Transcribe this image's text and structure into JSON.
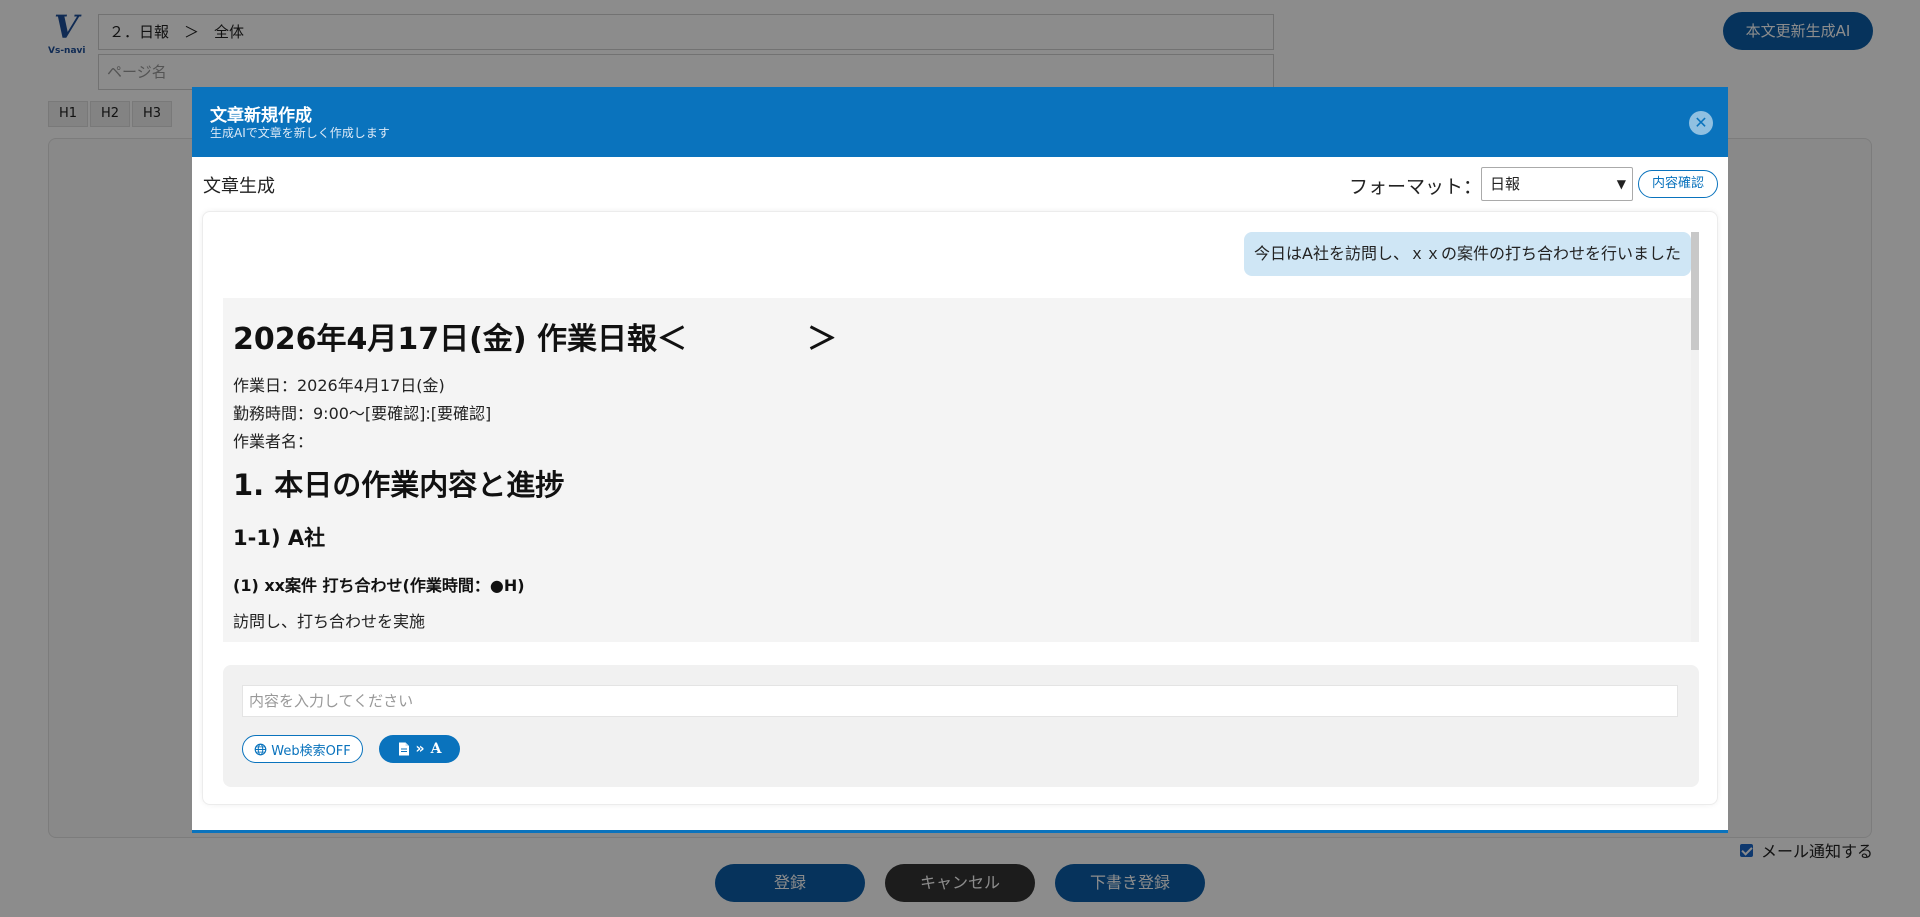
{
  "background": {
    "logo": {
      "mark": "V",
      "name": "Vs-navi"
    },
    "breadcrumb": "２．日報　＞　全体",
    "page_name_placeholder": "ページ名",
    "heading_buttons": [
      "H1",
      "H2",
      "H3"
    ],
    "top_ai_button": "本文更新生成AI",
    "mail_notify_label": "メール通知する",
    "buttons": {
      "register": "登録",
      "cancel": "キャンセル",
      "draft": "下書き登録"
    }
  },
  "modal": {
    "title": "文章新規作成",
    "subtitle": "生成AIで文章を新しく作成します",
    "close_glyph": "✕",
    "section_label": "文章生成",
    "format_label": "フォーマット：",
    "format_selected": "日報",
    "confirm_button": "内容確認",
    "user_message": "今日はA社を訪問し、ｘｘの案件の打ち合わせを行いました",
    "response": {
      "title": "2026年4月17日(金) 作業日報＜　　　　＞",
      "work_date": "作業日：2026年4月17日(金)",
      "work_hours": "勤務時間：9:00～[要確認]:[要確認]",
      "worker": "作業者名：",
      "h1": "1. 本日の作業内容と進捗",
      "h2": "1-1) A社",
      "h3": "(1) xx案件 打ち合わせ(作業時間：●H)",
      "text": "訪問し、打ち合わせを実施"
    },
    "prompt_placeholder": "内容を入力してください",
    "web_search_button": "Web検索OFF",
    "convert_button_glyph": "»",
    "convert_button_letter": "A"
  },
  "icons": {
    "globe": "globe-icon",
    "document": "document-icon",
    "close": "close-icon",
    "chevron": "chevron-down-icon"
  },
  "colors": {
    "primary": "#0a73bd",
    "dark_button": "#333333",
    "user_bubble": "#cfe6f5"
  }
}
